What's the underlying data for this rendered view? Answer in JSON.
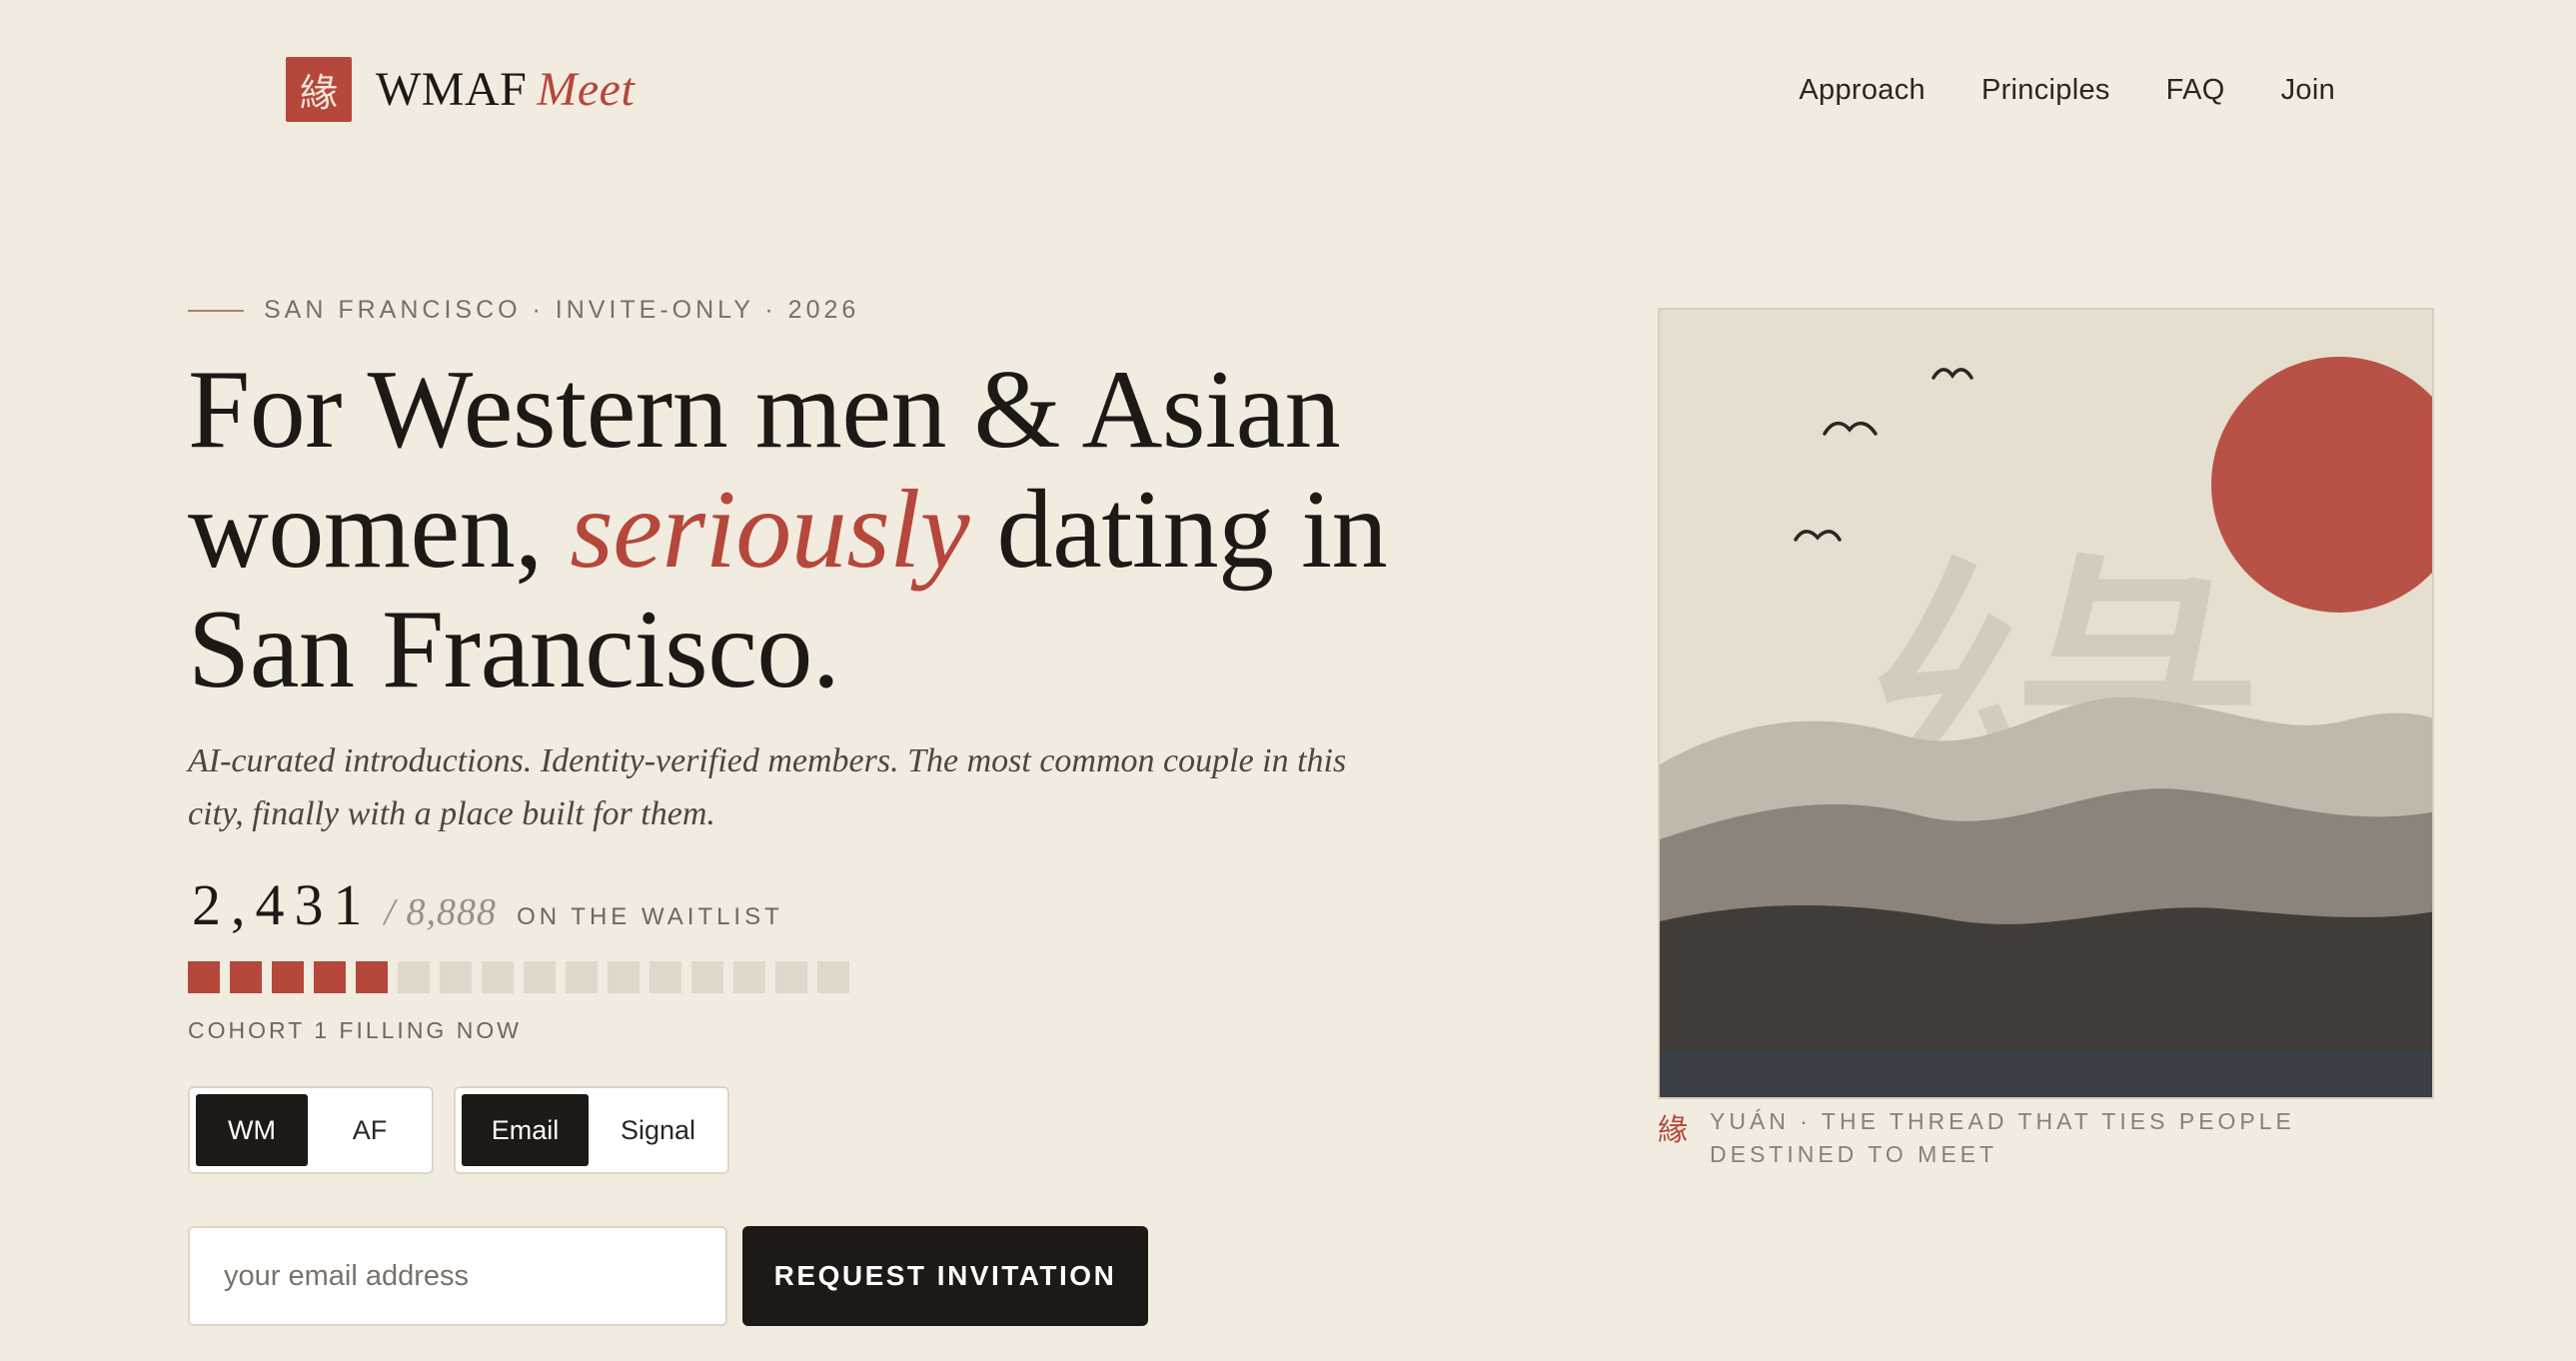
{
  "brand": {
    "mark": "緣",
    "name": "WMAF",
    "name_accent": "Meet"
  },
  "nav": [
    "Approach",
    "Principles",
    "FAQ",
    "Join"
  ],
  "hero": {
    "eyebrow": "SAN FRANCISCO · INVITE-ONLY · 2026",
    "headline_1": "For Western men & Asian women,",
    "headline_accent": "seriously",
    "headline_2": "dating in San Francisco.",
    "subtitle": "AI-curated introductions. Identity-verified members. The most common couple in this city, finally with a place built for them."
  },
  "waitlist": {
    "count": "2,431",
    "total": "/ 8,888",
    "label": "ON THE WAITLIST",
    "cohort_label": "COHORT 1 FILLING NOW",
    "segments_total": 16,
    "segments_filled": 5
  },
  "toggles": {
    "gender": {
      "options": [
        "WM",
        "AF"
      ],
      "selected": "WM"
    },
    "contact": {
      "options": [
        "Email",
        "Signal"
      ],
      "selected": "Email"
    }
  },
  "form": {
    "email_placeholder": "your email address",
    "submit_label": "REQUEST INVITATION"
  },
  "art": {
    "glyph": "緣",
    "caption_mark": "緣",
    "caption": "YUÁN · THE THREAD THAT TIES PEOPLE DESTINED TO MEET"
  },
  "colors": {
    "background": "#f2ebe0",
    "accent": "#b5473b",
    "ink": "#1c1917",
    "muted": "#7a6f64"
  }
}
